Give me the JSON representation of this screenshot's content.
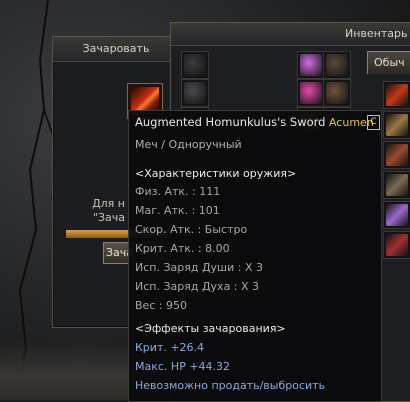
{
  "enchant_window": {
    "title": "Зачаровать",
    "desc_line1": "Для н",
    "desc_line2": "\"Зача",
    "button_label": "Зача",
    "progress": 1.0,
    "colors": {
      "frame": "#5a554c",
      "progress": "#d7a24c"
    }
  },
  "inventory_window": {
    "title": "Инвентарь",
    "tab_label": "Обыч",
    "slots": [
      {
        "icon": "helmet-icon",
        "color": "#3b3b3e"
      },
      {
        "icon": "pink-crystal-icon",
        "color": "#d46be2"
      },
      {
        "icon": "armor-icon",
        "color": "#5b4a3a"
      },
      {
        "icon": "helmet-icon",
        "color": "#4a4b4e"
      },
      {
        "icon": "flame-gem-icon",
        "color": "#e44aa8"
      },
      {
        "icon": "gear-icon",
        "color": "#70533b"
      },
      {
        "icon": "dark-item-icon",
        "color": "#2b2b2c"
      },
      {
        "icon": "lightning-icon",
        "color": "#e0c22b"
      },
      {
        "icon": "green-gem-icon",
        "color": "#3a6e3a"
      }
    ],
    "right_column": [
      {
        "icon": "sword-icon",
        "color": "#c33a18"
      },
      {
        "icon": "blade-icon",
        "color": "#9a7a40"
      },
      {
        "icon": "item-icon",
        "color": "#9a4a30"
      },
      {
        "icon": "item-icon",
        "color": "#7a6a50"
      },
      {
        "icon": "crystal-icon",
        "color": "#9a6ac8"
      },
      {
        "icon": "item-icon",
        "color": "#a03030"
      }
    ]
  },
  "tooltip": {
    "item_name": "Augmented Homunkulus's Sword",
    "grade": "Acumen",
    "corner_badge": "C",
    "subtitle": "Меч / Одноручный",
    "weapon_stats_header": "<Характеристики оружия>",
    "stats": [
      "Физ. Атк. : 111",
      "Маг. Атк. : 101",
      "Скор. Атк. : Быстро",
      "Крит. Атк. : 8.00",
      "Исп. Заряд Души : X 3",
      "Исп. Заряд Духа : X 3",
      "Вес : 950"
    ],
    "enchant_header": "<Эффекты зачарования>",
    "enchant_effects": [
      "Крит. +26.4",
      "Макс. HP +44.32",
      "Невозможно продать/выбросить"
    ],
    "colors": {
      "name": "#e8e8e8",
      "grade": "#e0c14a",
      "stat": "#a7a7a7",
      "effect": "#8ea9d8"
    }
  }
}
